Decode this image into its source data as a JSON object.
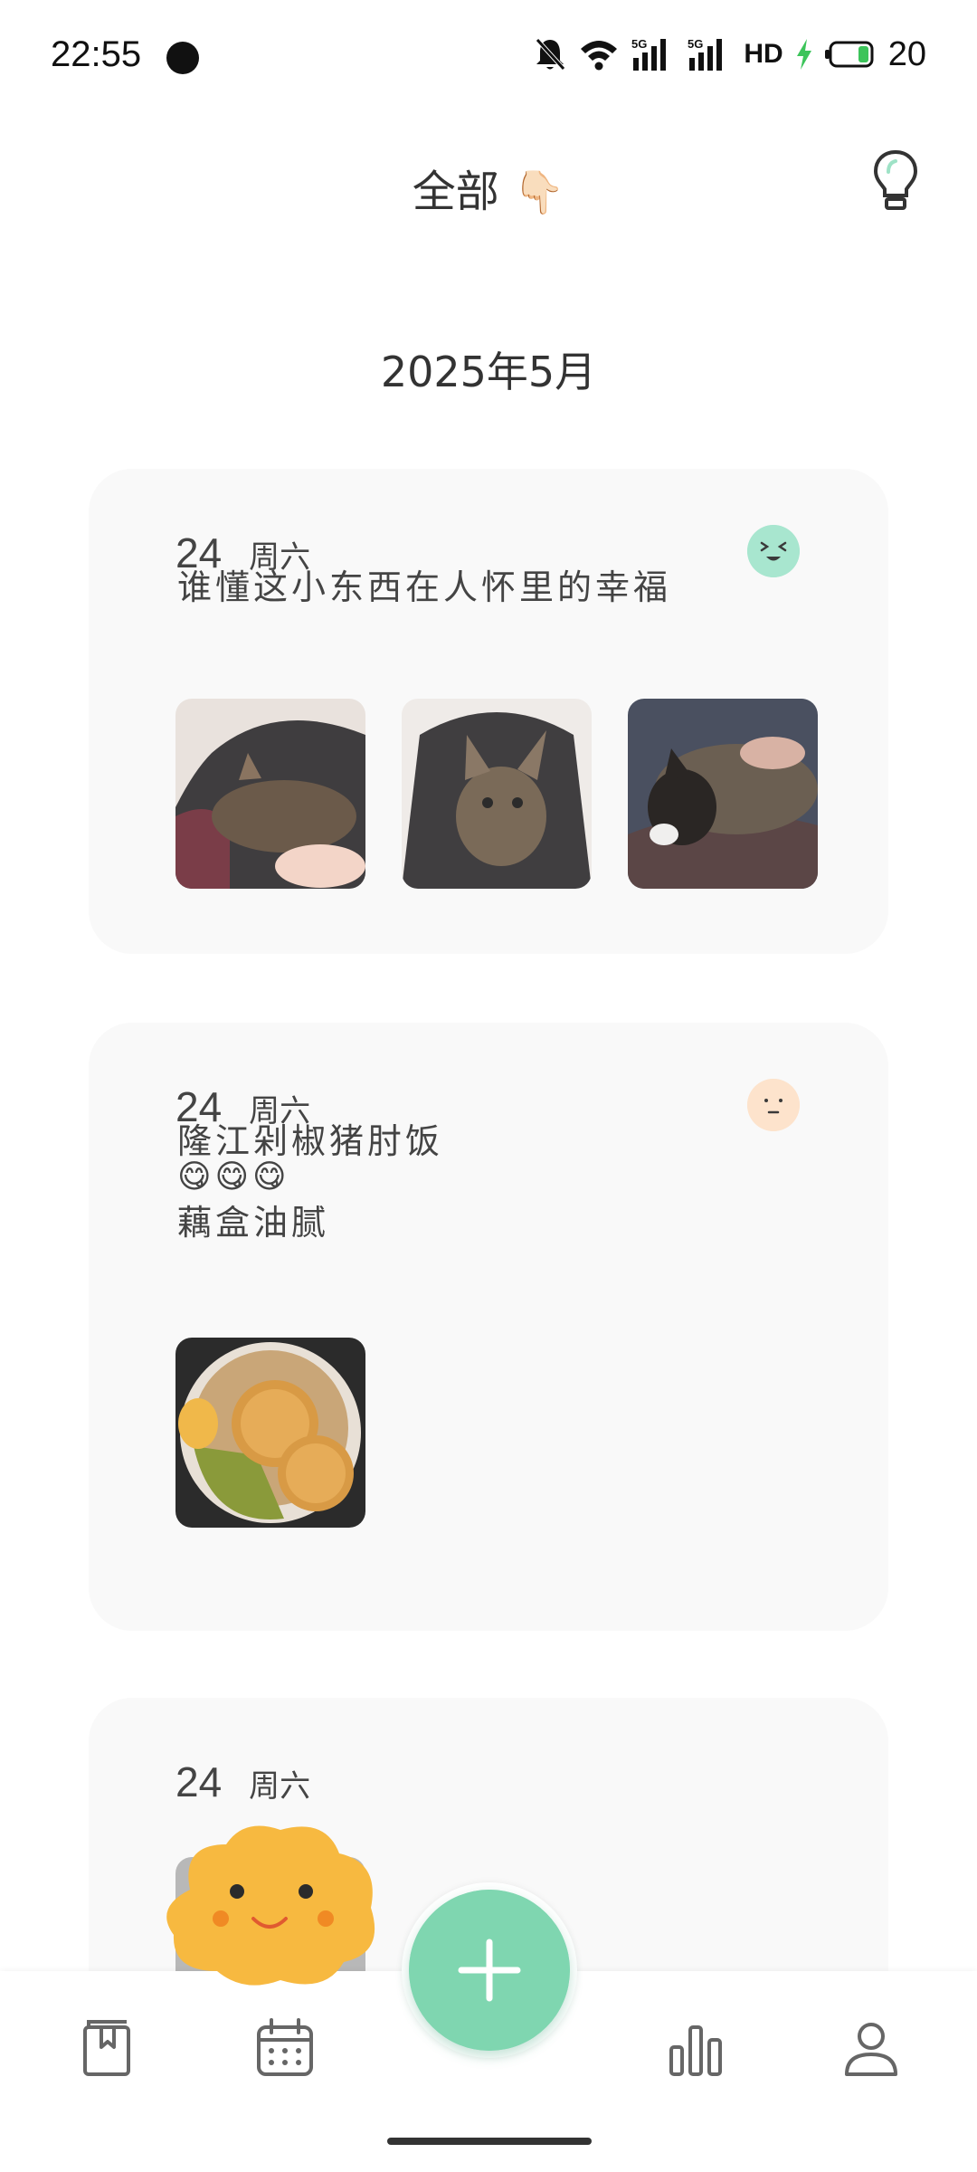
{
  "status_bar": {
    "time": "22:55",
    "network_label": "HD",
    "signal_1_label": "5G",
    "signal_2_label": "5G",
    "battery_level": "20",
    "icons": [
      "bell-off-icon",
      "wifi-icon",
      "signal-5g-icon",
      "signal-5g-icon",
      "hd-icon",
      "charging-icon",
      "battery-icon"
    ]
  },
  "header": {
    "title": "全部",
    "title_emoji": "👇🏻",
    "bulb_icon": "lightbulb-icon"
  },
  "month_label": "2025年5月",
  "entries": [
    {
      "day": "24",
      "weekday": "周六",
      "mood": "mood-happy-icon",
      "mood_color": "#a8e6cf",
      "lines": [
        "谁懂这小东西在人怀里的幸福"
      ],
      "photos": [
        "cat-photo-1",
        "cat-photo-2",
        "cat-photo-3"
      ]
    },
    {
      "day": "24",
      "weekday": "周六",
      "mood": "mood-neutral-icon",
      "mood_color": "#fde3cc",
      "lines": [
        "隆江剁椒猪肘饭",
        "😋😋😋",
        "藕盒油腻"
      ],
      "photos": [
        "food-photo-1"
      ]
    },
    {
      "day": "24",
      "weekday": "周六",
      "lines": [],
      "photos": []
    }
  ],
  "bottom_nav": {
    "items": [
      "diary-icon",
      "calendar-icon",
      "add-icon",
      "stats-icon",
      "profile-icon"
    ],
    "accent_color": "#7fd6b0"
  }
}
